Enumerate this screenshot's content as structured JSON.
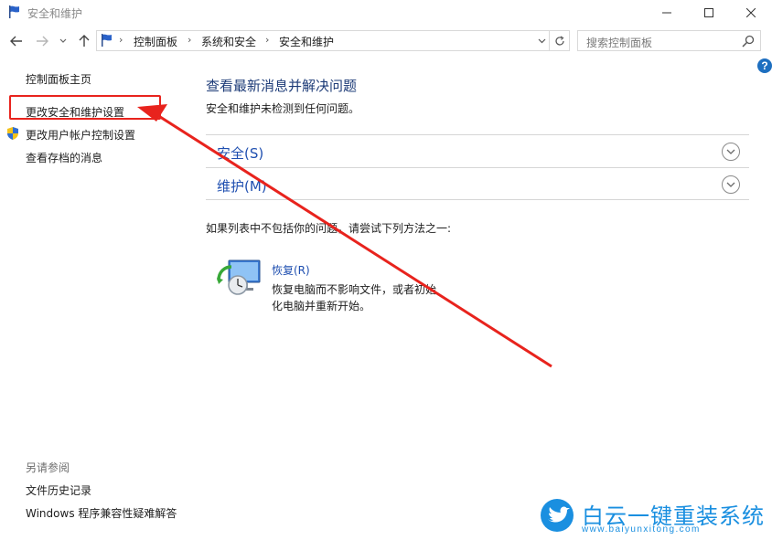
{
  "window": {
    "title": "安全和维护"
  },
  "address": {
    "breadcrumbs": [
      "控制面板",
      "系统和安全",
      "安全和维护"
    ]
  },
  "search": {
    "placeholder": "搜索控制面板"
  },
  "help": {
    "label": "?"
  },
  "sidebar": {
    "home": "控制面板主页",
    "items": [
      {
        "label": "更改安全和维护设置"
      },
      {
        "label": "更改用户帐户控制设置"
      },
      {
        "label": "查看存档的消息"
      }
    ],
    "see_also_heading": "另请参阅",
    "see_also": [
      {
        "label": "文件历史记录"
      },
      {
        "label": "Windows 程序兼容性疑难解答"
      }
    ]
  },
  "main": {
    "title": "查看最新消息并解决问题",
    "subtitle": "安全和维护未检测到任何问题。",
    "sections": [
      {
        "label": "安全(S)"
      },
      {
        "label": "维护(M)"
      }
    ],
    "hint": "如果列表中不包括你的问题，请尝试下列方法之一:",
    "recovery": {
      "title": "恢复(R)",
      "description": "恢复电脑而不影响文件，或者初始化电脑并重新开始。"
    }
  },
  "watermark": {
    "name": "白云一键重装系统",
    "url": "www.baiyunxitong.com"
  },
  "colors": {
    "annotation": "#e8231d",
    "link": "#1f4fb0",
    "heading": "#1e3c78",
    "watermark": "#1a8fe0"
  }
}
